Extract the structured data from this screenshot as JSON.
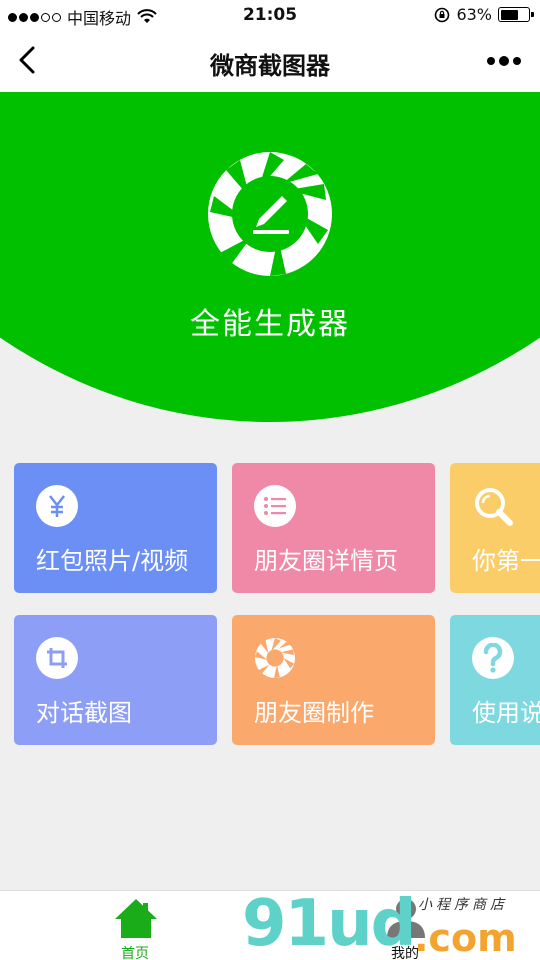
{
  "status_bar": {
    "carrier": "中国移动",
    "time": "21:05",
    "battery_percent": "63%",
    "battery_level": 0.63,
    "signal_bars_filled": 3,
    "signal_bars_total": 5
  },
  "nav": {
    "title": "微商截图器"
  },
  "hero": {
    "title": "全能生成器",
    "color": "#00c000"
  },
  "cards": [
    {
      "label": "红包照片/视频",
      "icon": "yen-icon",
      "color": "#6b8ff5"
    },
    {
      "label": "朋友圈详情页",
      "icon": "list-icon",
      "color": "#f088a8"
    },
    {
      "label": "你第一",
      "icon": "search-icon",
      "color": "#fbcd68"
    },
    {
      "label": "对话截图",
      "icon": "crop-icon",
      "color": "#8d9ef7"
    },
    {
      "label": "朋友圈制作",
      "icon": "aperture-icon",
      "color": "#fba86c"
    },
    {
      "label": "使用说",
      "icon": "question-icon",
      "color": "#7dd8e0"
    }
  ],
  "tab_bar": {
    "tabs": [
      {
        "label": "首页",
        "icon": "home-icon",
        "active": true
      },
      {
        "label": "我的",
        "icon": "user-icon",
        "active": false
      }
    ],
    "active_color": "#1aad19"
  },
  "watermark": {
    "main": "91ud",
    "suffix": ".com",
    "text": "小程序商店"
  }
}
